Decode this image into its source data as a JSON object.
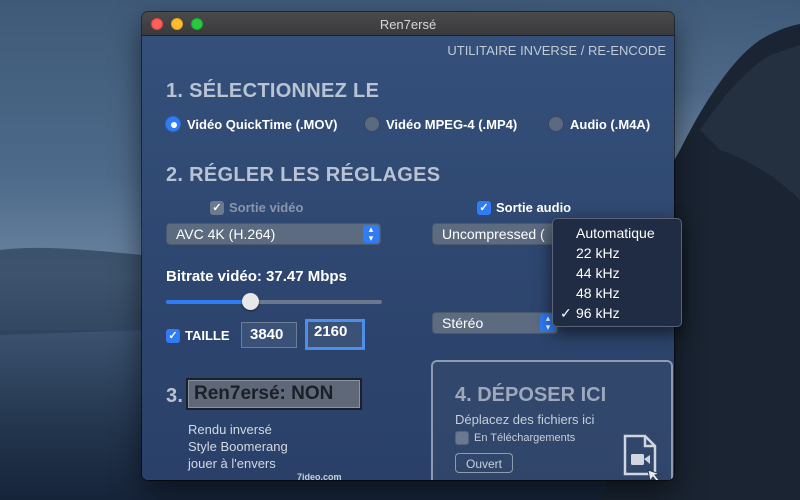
{
  "window": {
    "title": "Ren7ersé",
    "subtitle": "UTILITAIRE INVERSE / RE-ENCODE"
  },
  "step1": {
    "title": "1. SÉLECTIONNEZ LE",
    "options": [
      {
        "label": "Vidéo QuickTime (.MOV)",
        "selected": true
      },
      {
        "label": "Vidéo MPEG-4 (.MP4)",
        "selected": false
      },
      {
        "label": "Audio (.M4A)",
        "selected": false
      }
    ]
  },
  "step2": {
    "title": "2. RÉGLER LES RÉGLAGES",
    "video_output_label": "Sortie vidéo",
    "video_output_checked": true,
    "video_output_enabled": false,
    "audio_output_label": "Sortie audio",
    "audio_output_checked": true,
    "video_codec": "AVC 4K (H.264)",
    "audio_codec": "Uncompressed (",
    "bitrate_label": "Bitrate vidéo: 37.47 Mbps",
    "bitrate_fraction": 0.38,
    "size_label": "TAILLE",
    "size_checked": true,
    "width": "3840",
    "height": "2160",
    "channels": "Stéréo"
  },
  "step3": {
    "number": "3.",
    "button_label": "Ren7ersé: NON",
    "desc_lines": [
      "Rendu inversé",
      "Style Boomerang",
      "jouer à l'envers"
    ],
    "credit": "7ideo.com"
  },
  "step4": {
    "title": "4. DÉPOSER ICI",
    "subtitle": "Déplacez des fichiers ici",
    "downloads_label": "En Téléchargements",
    "open_label": "Ouvert"
  },
  "samplerate_menu": {
    "items": [
      "Automatique",
      "22 kHz",
      "44 kHz",
      "48 kHz",
      "96 kHz"
    ],
    "checked_item": "96 kHz",
    "check_mark": "✓"
  }
}
